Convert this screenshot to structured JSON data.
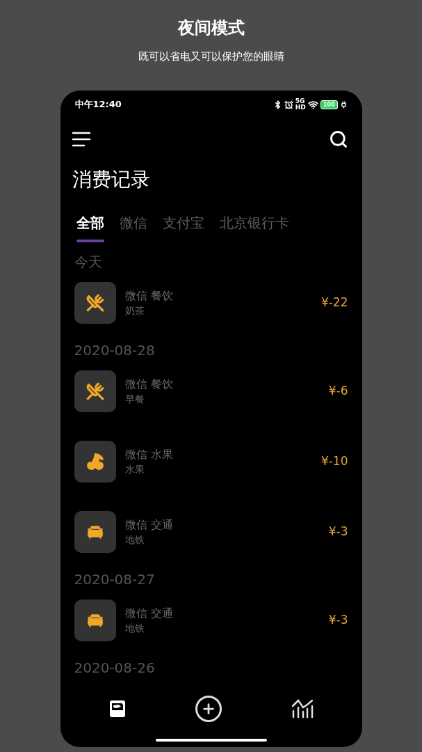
{
  "banner": {
    "title": "夜间模式",
    "subtitle": "既可以省电又可以保护您的眼睛"
  },
  "status_bar": {
    "time": "中午12:40",
    "network": [
      "5G",
      "HD"
    ],
    "battery": "100"
  },
  "page_title": "消费记录",
  "tabs": [
    {
      "label": "全部",
      "selected": true
    },
    {
      "label": "微信",
      "selected": false
    },
    {
      "label": "支付宝",
      "selected": false
    },
    {
      "label": "北京银行卡",
      "selected": false
    }
  ],
  "groups": [
    {
      "date": "今天",
      "records": [
        {
          "kind": "food",
          "source": "微信",
          "category": "餐饮",
          "note": "奶茶",
          "amount": "¥-22"
        }
      ]
    },
    {
      "date": "2020-08-28",
      "records": [
        {
          "kind": "food",
          "source": "微信",
          "category": "餐饮",
          "note": "早餐",
          "amount": "¥-6"
        },
        {
          "kind": "fruit",
          "source": "微信",
          "category": "水果",
          "note": "水果",
          "amount": "¥-10"
        },
        {
          "kind": "car",
          "source": "微信",
          "category": "交通",
          "note": "地铁",
          "amount": "¥-3"
        }
      ]
    },
    {
      "date": "2020-08-27",
      "records": [
        {
          "kind": "car",
          "source": "微信",
          "category": "交通",
          "note": "地铁",
          "amount": "¥-3"
        }
      ]
    },
    {
      "date": "2020-08-26"
    }
  ]
}
